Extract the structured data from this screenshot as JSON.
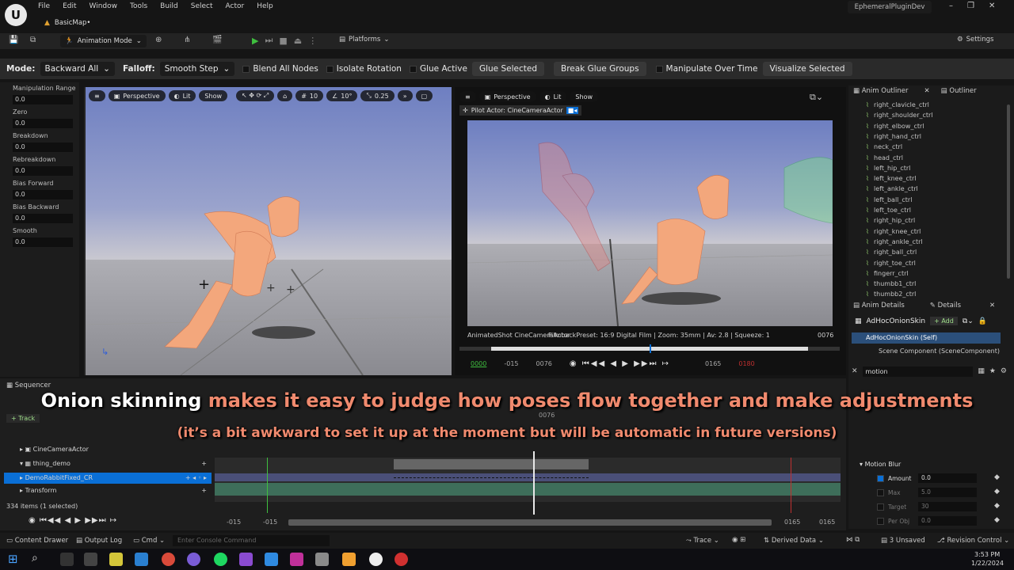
{
  "menu": {
    "items": [
      "File",
      "Edit",
      "Window",
      "Tools",
      "Build",
      "Select",
      "Actor",
      "Help"
    ],
    "map_tab": "BasicMap•",
    "project": "EphemeralPluginDev"
  },
  "toolbar": {
    "animation_mode": "Animation Mode",
    "platforms": "Platforms",
    "settings": "Settings"
  },
  "modebar": {
    "mode_label": "Mode:",
    "mode_value": "Backward All",
    "falloff_label": "Falloff:",
    "falloff_value": "Smooth Step",
    "blend_all_nodes": "Blend All Nodes",
    "isolate_rotation": "Isolate Rotation",
    "glue_active": "Glue Active",
    "glue_selected": "Glue Selected",
    "break_glue_groups": "Break Glue Groups",
    "manipulate_over_time": "Manipulate Over Time",
    "visualize_selected": "Visualize Selected"
  },
  "left_panel": {
    "fields": [
      {
        "label": "Manipulation Range",
        "value": "0.0"
      },
      {
        "label": "Zero",
        "value": "0.0"
      },
      {
        "label": "Breakdown",
        "value": "0.0"
      },
      {
        "label": "Rebreakdown",
        "value": "0.0"
      },
      {
        "label": "Bias Forward",
        "value": "0.0"
      },
      {
        "label": "Bias Backward",
        "value": "0.0"
      },
      {
        "label": "Smooth",
        "value": "0.0"
      }
    ]
  },
  "viewport_left": {
    "perspective": "Perspective",
    "lit": "Lit",
    "show": "Show",
    "grid": "10",
    "angle": "10°",
    "scale": "0.25"
  },
  "viewport_right": {
    "perspective": "Perspective",
    "lit": "Lit",
    "show": "Show",
    "pilot": "Pilot Actor: CineCameraActor",
    "shot_info": "AnimatedShot  CineCameraActor",
    "filmback": "FilmbackPreset: 16:9 Digital Film | Zoom: 35mm | Av: 2.8 | Squeeze: 1",
    "frame_current": "0076",
    "timeline": {
      "start": "0000",
      "in": "-015",
      "current": "0076",
      "out": "0165",
      "end": "0180"
    }
  },
  "outliner": {
    "tab_anim": "Anim Outliner",
    "tab_outliner": "Outliner",
    "bones": [
      "right_clavicle_ctrl",
      "right_shoulder_ctrl",
      "right_elbow_ctrl",
      "right_hand_ctrl",
      "neck_ctrl",
      "head_ctrl",
      "left_hip_ctrl",
      "left_knee_ctrl",
      "left_ankle_ctrl",
      "left_ball_ctrl",
      "left_toe_ctrl",
      "right_hip_ctrl",
      "right_knee_ctrl",
      "right_ankle_ctrl",
      "right_ball_ctrl",
      "right_toe_ctrl",
      "fingerr_ctrl",
      "thumbb1_ctrl",
      "thumbb2_ctrl"
    ]
  },
  "details": {
    "tab_anim": "Anim Details",
    "tab_details": "Details",
    "component": "AdHocOnionSkin",
    "add": "+ Add",
    "self_item": "AdHocOnionSkin (Self)",
    "scene_item": "Scene Component (SceneComponent)",
    "search": "motion",
    "section": "Motion Blur",
    "rows": [
      {
        "label": "Amount",
        "value": "0.0"
      },
      {
        "label": "Max",
        "value": "5.0"
      },
      {
        "label": "Target",
        "value": "30"
      },
      {
        "label": "Per Obj",
        "value": "0.0"
      }
    ]
  },
  "sequencer": {
    "tab": "Sequencer",
    "add_track": "+ Track",
    "tracks": [
      "CineCameraActor",
      "thing_demo",
      "DemoRabbitFixed_CR",
      "Transform"
    ],
    "items_count": "334 items (1 selected)",
    "frame_marker": "0076",
    "range_left": "-015",
    "range_left2": "-015",
    "range_right": "0165",
    "range_right2": "0165"
  },
  "captions": {
    "line1_white": "Onion skinning",
    "line1_orange": " makes it easy to judge how poses flow together and make adjustments",
    "line2": "(it’s a bit awkward to set it up at the moment but will be automatic in future versions)"
  },
  "statusbar": {
    "content_drawer": "Content Drawer",
    "output_log": "Output Log",
    "cmd": "Cmd",
    "console_placeholder": "Enter Console Command",
    "trace": "Trace",
    "derived_data": "Derived Data",
    "unsaved": "3 Unsaved",
    "revision": "Revision Control"
  },
  "taskbar": {
    "time": "3:53 PM",
    "date": "1/22/2024"
  },
  "colors": {
    "accent_blue": "#0a6fd6",
    "caption_orange": "#f08a6e",
    "play_green": "#3fbf3f",
    "timeline_red": "#c03030"
  }
}
